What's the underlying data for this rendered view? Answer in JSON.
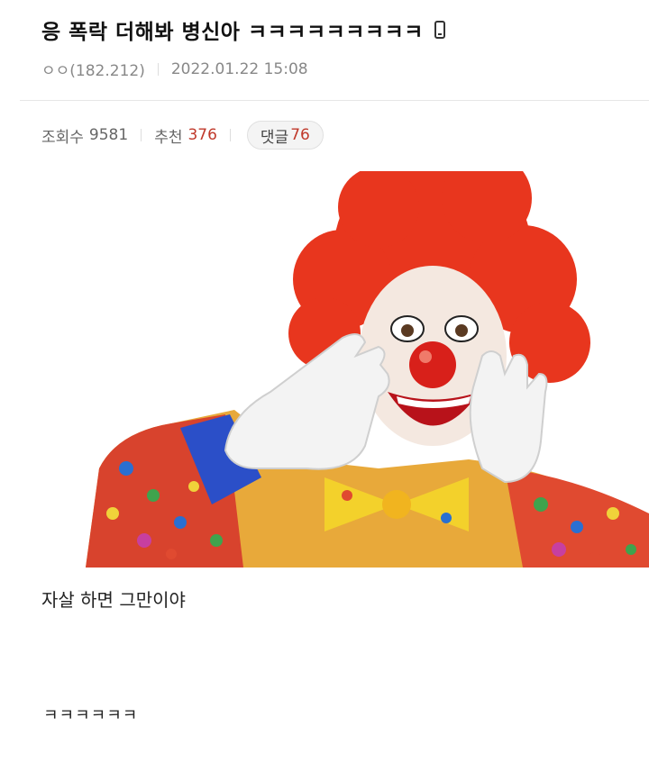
{
  "post": {
    "title": "응 폭락 더해봐 병신아 ㅋㅋㅋㅋㅋㅋㅋㅋㅋ",
    "device_icon": "mobile-phone-icon",
    "author": "ㅇㅇ(182.212)",
    "datetime": "2022.01.22 15:08"
  },
  "stats": {
    "views_label": "조회수",
    "views": "9581",
    "recommend_label": "추천",
    "recommend": "376",
    "comments_label": "댓글",
    "comments": "76"
  },
  "body": {
    "image_icon": "clown-image",
    "caption": "자살 하면 그만이야",
    "laugh": "ㅋㅋㅋㅋㅋㅋ"
  },
  "colors": {
    "accent_red": "#c0392b"
  }
}
